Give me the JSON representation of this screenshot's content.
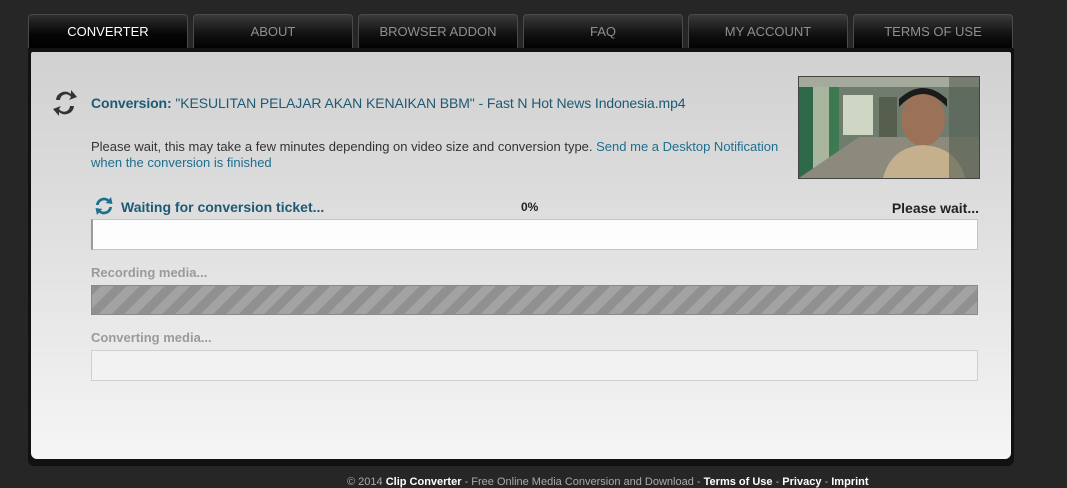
{
  "nav": {
    "tabs": [
      {
        "label": "CONVERTER"
      },
      {
        "label": "ABOUT"
      },
      {
        "label": "BROWSER ADDON"
      },
      {
        "label": "FAQ"
      },
      {
        "label": "MY ACCOUNT"
      },
      {
        "label": "TERMS OF USE"
      }
    ],
    "active": "CONVERTER"
  },
  "conversion": {
    "label": "Conversion:",
    "filename": "\"KESULITAN PELAJAR AKAN KENAIKAN BBM\" - Fast N Hot News Indonesia.mp4",
    "wait_text": "Please wait, this may take a few minutes depending on video size and conversion type.",
    "notification_link": "Send me a Desktop Notification when the conversion is finished"
  },
  "stages": {
    "ticket": {
      "label": "Waiting for conversion ticket...",
      "percent": "0%",
      "status": "Please wait...",
      "progress": 0
    },
    "recording": {
      "label": "Recording media..."
    },
    "converting": {
      "label": "Converting media..."
    }
  },
  "footer": {
    "copyright": "© 2014",
    "brand": "Clip Converter",
    "sep1": " - ",
    "tagline": "Free Online Media Conversion and Download",
    "sep2": " - ",
    "terms": "Terms of Use",
    "sep3": " - ",
    "privacy": "Privacy",
    "sep4": " - ",
    "imprint": "Imprint"
  },
  "colors": {
    "accent": "#1e5a74",
    "link": "#1e6e8f",
    "background": "#262626"
  },
  "icons": {
    "title": "sync-arrows-icon",
    "stage": "refresh-spinner-icon"
  }
}
